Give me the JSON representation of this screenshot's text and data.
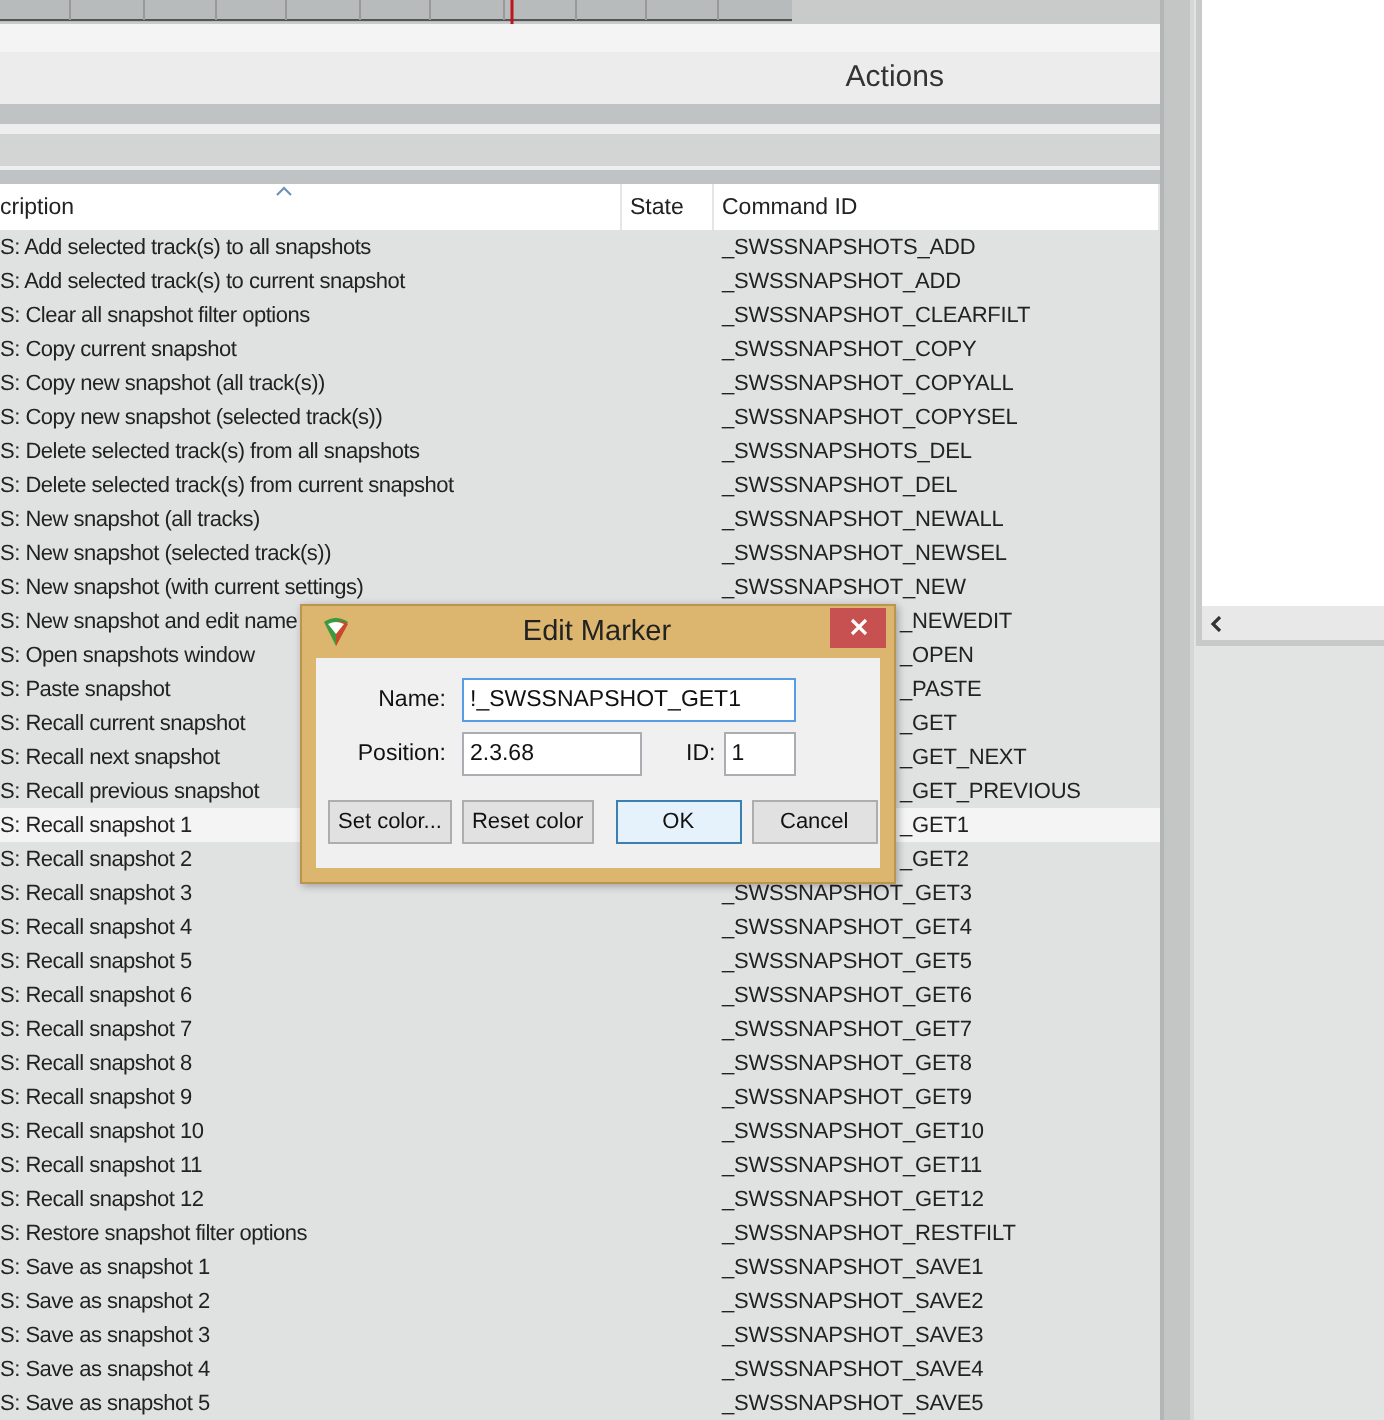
{
  "window": {
    "title": "Actions"
  },
  "table": {
    "columns": [
      {
        "label": "cription",
        "sorted": true
      },
      {
        "label": "State"
      },
      {
        "label": "Command ID"
      }
    ],
    "rows": [
      {
        "kind": "row",
        "selected": false,
        "description": "S: Add selected track(s) to all snapshots",
        "command_id": "_SWSSNAPSHOTS_ADD"
      },
      {
        "kind": "row",
        "selected": false,
        "description": "S: Add selected track(s) to current snapshot",
        "command_id": "_SWSSNAPSHOT_ADD"
      },
      {
        "kind": "row",
        "selected": false,
        "description": "S: Clear all snapshot filter options",
        "command_id": "_SWSSNAPSHOT_CLEARFILT"
      },
      {
        "kind": "row",
        "selected": false,
        "description": "S: Copy current snapshot",
        "command_id": "_SWSSNAPSHOT_COPY"
      },
      {
        "kind": "row",
        "selected": false,
        "description": "S: Copy new snapshot (all track(s))",
        "command_id": "_SWSSNAPSHOT_COPYALL"
      },
      {
        "kind": "row",
        "selected": false,
        "description": "S: Copy new snapshot (selected track(s))",
        "command_id": "_SWSSNAPSHOT_COPYSEL"
      },
      {
        "kind": "row",
        "selected": false,
        "description": "S: Delete selected track(s) from all snapshots",
        "command_id": "_SWSSNAPSHOTS_DEL"
      },
      {
        "kind": "row",
        "selected": false,
        "description": "S: Delete selected track(s) from current snapshot",
        "command_id": "_SWSSNAPSHOT_DEL"
      },
      {
        "kind": "row",
        "selected": false,
        "description": "S: New snapshot (all tracks)",
        "command_id": "_SWSSNAPSHOT_NEWALL"
      },
      {
        "kind": "row",
        "selected": false,
        "description": "S: New snapshot (selected track(s))",
        "command_id": "_SWSSNAPSHOT_NEWSEL"
      },
      {
        "kind": "row",
        "selected": false,
        "description": "S: New snapshot (with current settings)",
        "command_id": "_SWSSNAPSHOT_NEW"
      },
      {
        "kind": "covered",
        "selected": false,
        "description": "S: New snapshot and edit name",
        "command_id": "_NEWEDIT"
      },
      {
        "kind": "covered",
        "selected": false,
        "description": "S: Open snapshots window",
        "command_id": "_OPEN"
      },
      {
        "kind": "covered",
        "selected": false,
        "description": "S: Paste snapshot",
        "command_id": "_PASTE"
      },
      {
        "kind": "covered",
        "selected": false,
        "description": "S: Recall current snapshot",
        "command_id": "_GET"
      },
      {
        "kind": "covered",
        "selected": false,
        "description": "S: Recall next snapshot",
        "command_id": "_GET_NEXT"
      },
      {
        "kind": "covered",
        "selected": false,
        "description": "S: Recall previous snapshot",
        "command_id": "_GET_PREVIOUS"
      },
      {
        "kind": "covered",
        "selected": true,
        "description": "S: Recall snapshot 1",
        "command_id": "_GET1"
      },
      {
        "kind": "covered",
        "selected": false,
        "description": "S: Recall snapshot 2",
        "command_id": "_GET2"
      },
      {
        "kind": "row",
        "selected": false,
        "description": "S: Recall snapshot 3",
        "command_id": "_SWSSNAPSHOT_GET3"
      },
      {
        "kind": "row",
        "selected": false,
        "description": "S: Recall snapshot 4",
        "command_id": "_SWSSNAPSHOT_GET4"
      },
      {
        "kind": "row",
        "selected": false,
        "description": "S: Recall snapshot 5",
        "command_id": "_SWSSNAPSHOT_GET5"
      },
      {
        "kind": "row",
        "selected": false,
        "description": "S: Recall snapshot 6",
        "command_id": "_SWSSNAPSHOT_GET6"
      },
      {
        "kind": "row",
        "selected": false,
        "description": "S: Recall snapshot 7",
        "command_id": "_SWSSNAPSHOT_GET7"
      },
      {
        "kind": "row",
        "selected": false,
        "description": "S: Recall snapshot 8",
        "command_id": "_SWSSNAPSHOT_GET8"
      },
      {
        "kind": "row",
        "selected": false,
        "description": "S: Recall snapshot 9",
        "command_id": "_SWSSNAPSHOT_GET9"
      },
      {
        "kind": "row",
        "selected": false,
        "description": "S: Recall snapshot 10",
        "command_id": "_SWSSNAPSHOT_GET10"
      },
      {
        "kind": "row",
        "selected": false,
        "description": "S: Recall snapshot 11",
        "command_id": "_SWSSNAPSHOT_GET11"
      },
      {
        "kind": "row",
        "selected": false,
        "description": "S: Recall snapshot 12",
        "command_id": "_SWSSNAPSHOT_GET12"
      },
      {
        "kind": "row",
        "selected": false,
        "description": "S: Restore snapshot filter options",
        "command_id": "_SWSSNAPSHOT_RESTFILT"
      },
      {
        "kind": "row",
        "selected": false,
        "description": "S: Save as snapshot 1",
        "command_id": "_SWSSNAPSHOT_SAVE1"
      },
      {
        "kind": "row",
        "selected": false,
        "description": "S: Save as snapshot 2",
        "command_id": "_SWSSNAPSHOT_SAVE2"
      },
      {
        "kind": "row",
        "selected": false,
        "description": "S: Save as snapshot 3",
        "command_id": "_SWSSNAPSHOT_SAVE3"
      },
      {
        "kind": "row",
        "selected": false,
        "description": "S: Save as snapshot 4",
        "command_id": "_SWSSNAPSHOT_SAVE4"
      },
      {
        "kind": "row",
        "selected": false,
        "description": "S: Save as snapshot 5",
        "command_id": "_SWSSNAPSHOT_SAVE5"
      }
    ]
  },
  "dialog": {
    "title": "Edit Marker",
    "name_label": "Name:",
    "name_value": "!_SWSSNAPSHOT_GET1",
    "position_label": "Position:",
    "position_value": "2.3.68",
    "id_label": "ID:",
    "id_value": "1",
    "buttons": [
      {
        "label": "Set color...",
        "default": false
      },
      {
        "label": "Reset color",
        "default": false
      },
      {
        "label": "OK",
        "default": true
      },
      {
        "label": "Cancel",
        "default": false
      }
    ]
  }
}
